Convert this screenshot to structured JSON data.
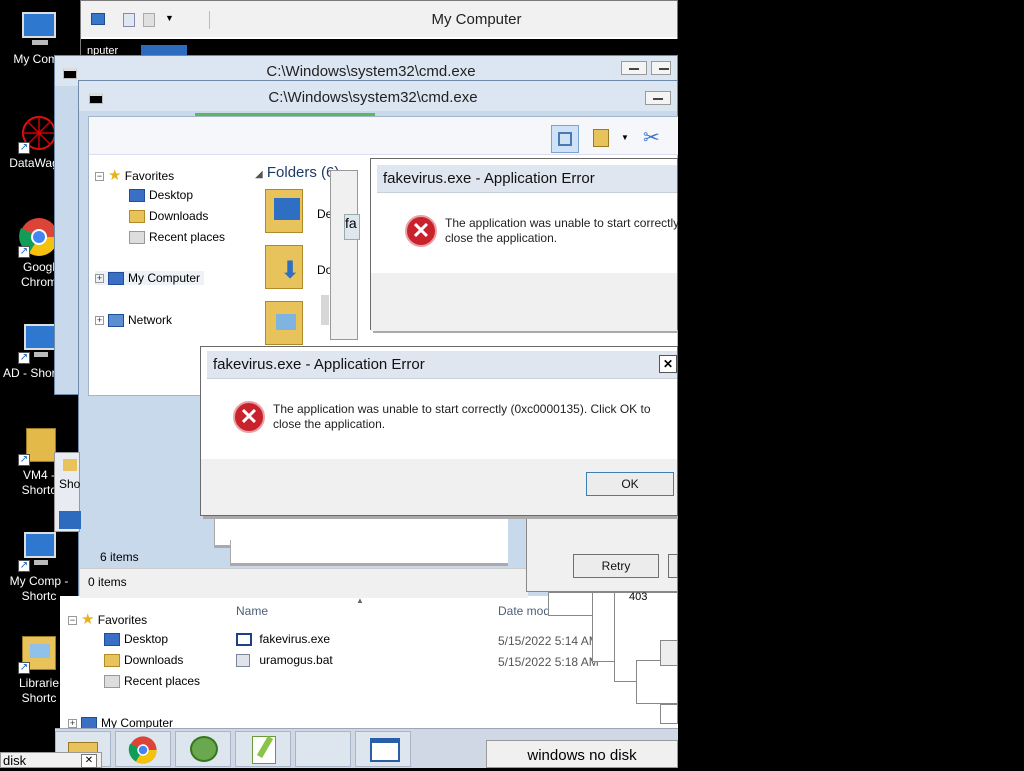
{
  "desktop": {
    "icons": [
      {
        "label": "My Comp",
        "icon": "computer-icon"
      },
      {
        "label": "DataWag...",
        "icon": "datawagon-icon"
      },
      {
        "label": "Googl Chrom",
        "icon": "chrome-icon"
      },
      {
        "label": "AD - Shortcut",
        "icon": "computer-shortcut-icon"
      },
      {
        "label": "VM4 - Shortc",
        "icon": "folder-shortcut-icon"
      },
      {
        "label": "My Comp - Shortc",
        "icon": "computer-shortcut-icon"
      },
      {
        "label": "Librarie Shortc",
        "icon": "libraries-icon"
      }
    ]
  },
  "top_window": {
    "title": "My Computer",
    "partial_label": "nputer"
  },
  "cmd_back": {
    "title": "C:\\Windows\\system32\\cmd.exe"
  },
  "cmd_front": {
    "title": "C:\\Windows\\system32\\cmd.exe"
  },
  "explorer_upper": {
    "tree": {
      "favorites": "Favorites",
      "desktop": "Desktop",
      "downloads": "Downloads",
      "recent": "Recent places",
      "my_computer": "My Computer",
      "network": "Network"
    },
    "folders_header": "Folders (6)",
    "folder_labels": [
      "Desk",
      "Do"
    ],
    "status": "6 items"
  },
  "explorer_lower": {
    "status_partial": "0 items",
    "tree": {
      "favorites": "Favorites",
      "desktop": "Desktop",
      "downloads": "Downloads",
      "recent": "Recent places",
      "my_computer": "My Computer"
    },
    "columns": {
      "name": "Name",
      "date": "Date mod"
    },
    "files": [
      {
        "name": "fakevirus.exe",
        "date": "5/15/2022 5:14 AM",
        "icon": "exe-icon"
      },
      {
        "name": "uramogus.bat",
        "date": "5/15/2022 5:18 AM",
        "icon": "bat-icon"
      }
    ]
  },
  "error_dialog_back": {
    "title": "fakevirus.exe - Application Error",
    "message_line1": "The application was unable to start correctly",
    "message_line2": "close the application."
  },
  "error_dialog_front": {
    "title": "fakevirus.exe - Application Error",
    "message_line1": "The application was unable to start correctly (0xc0000135). Click OK to",
    "message_line2": "close the application.",
    "ok_label": "OK",
    "close_glyph": "✕"
  },
  "retry_dialog": {
    "retry_label": "Retry",
    "number": "403"
  },
  "partial_fa": "fa",
  "partial_sho": "Sho",
  "taskbar": {
    "items": [
      "explorer",
      "chrome",
      "frog-app",
      "notepad-plus-plus",
      "blank",
      "window"
    ],
    "windows_no_disk": "windows no disk"
  },
  "bottom_left": {
    "label": "disk",
    "close_glyph": "✕"
  }
}
